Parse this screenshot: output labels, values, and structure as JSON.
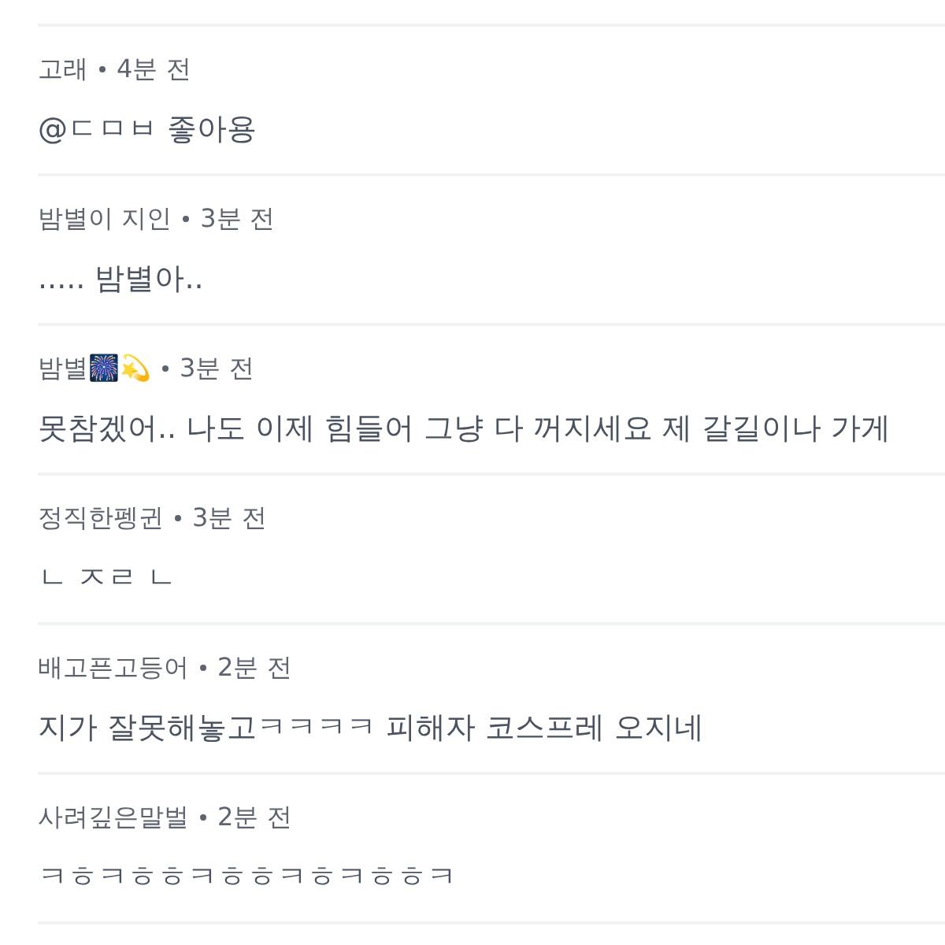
{
  "comments": [
    {
      "author": "고래",
      "time": "4분 전",
      "text": "@ㄷㅁㅂ 좋아용"
    },
    {
      "author": "밤별이 지인",
      "time": "3분 전",
      "text": "..... 밤별아.."
    },
    {
      "author": "밤별🎆💫",
      "time": "3분 전",
      "text": "못참겠어.. 나도 이제 힘들어 그냥 다 꺼지세요 제 갈길이나 가게"
    },
    {
      "author": "정직한펭귄",
      "time": "3분 전",
      "text": "ㄴ ㅈㄹ ㄴ"
    },
    {
      "author": "배고픈고등어",
      "time": "2분 전",
      "text": "지가 잘못해놓고ㅋㅋㅋㅋ 피해자 코스프레 오지네"
    },
    {
      "author": "사려깊은말벌",
      "time": "2분 전",
      "text": "ㅋㅎㅋㅎㅎㅋㅎㅎㅋㅎㅋㅎㅎㅋ"
    }
  ]
}
